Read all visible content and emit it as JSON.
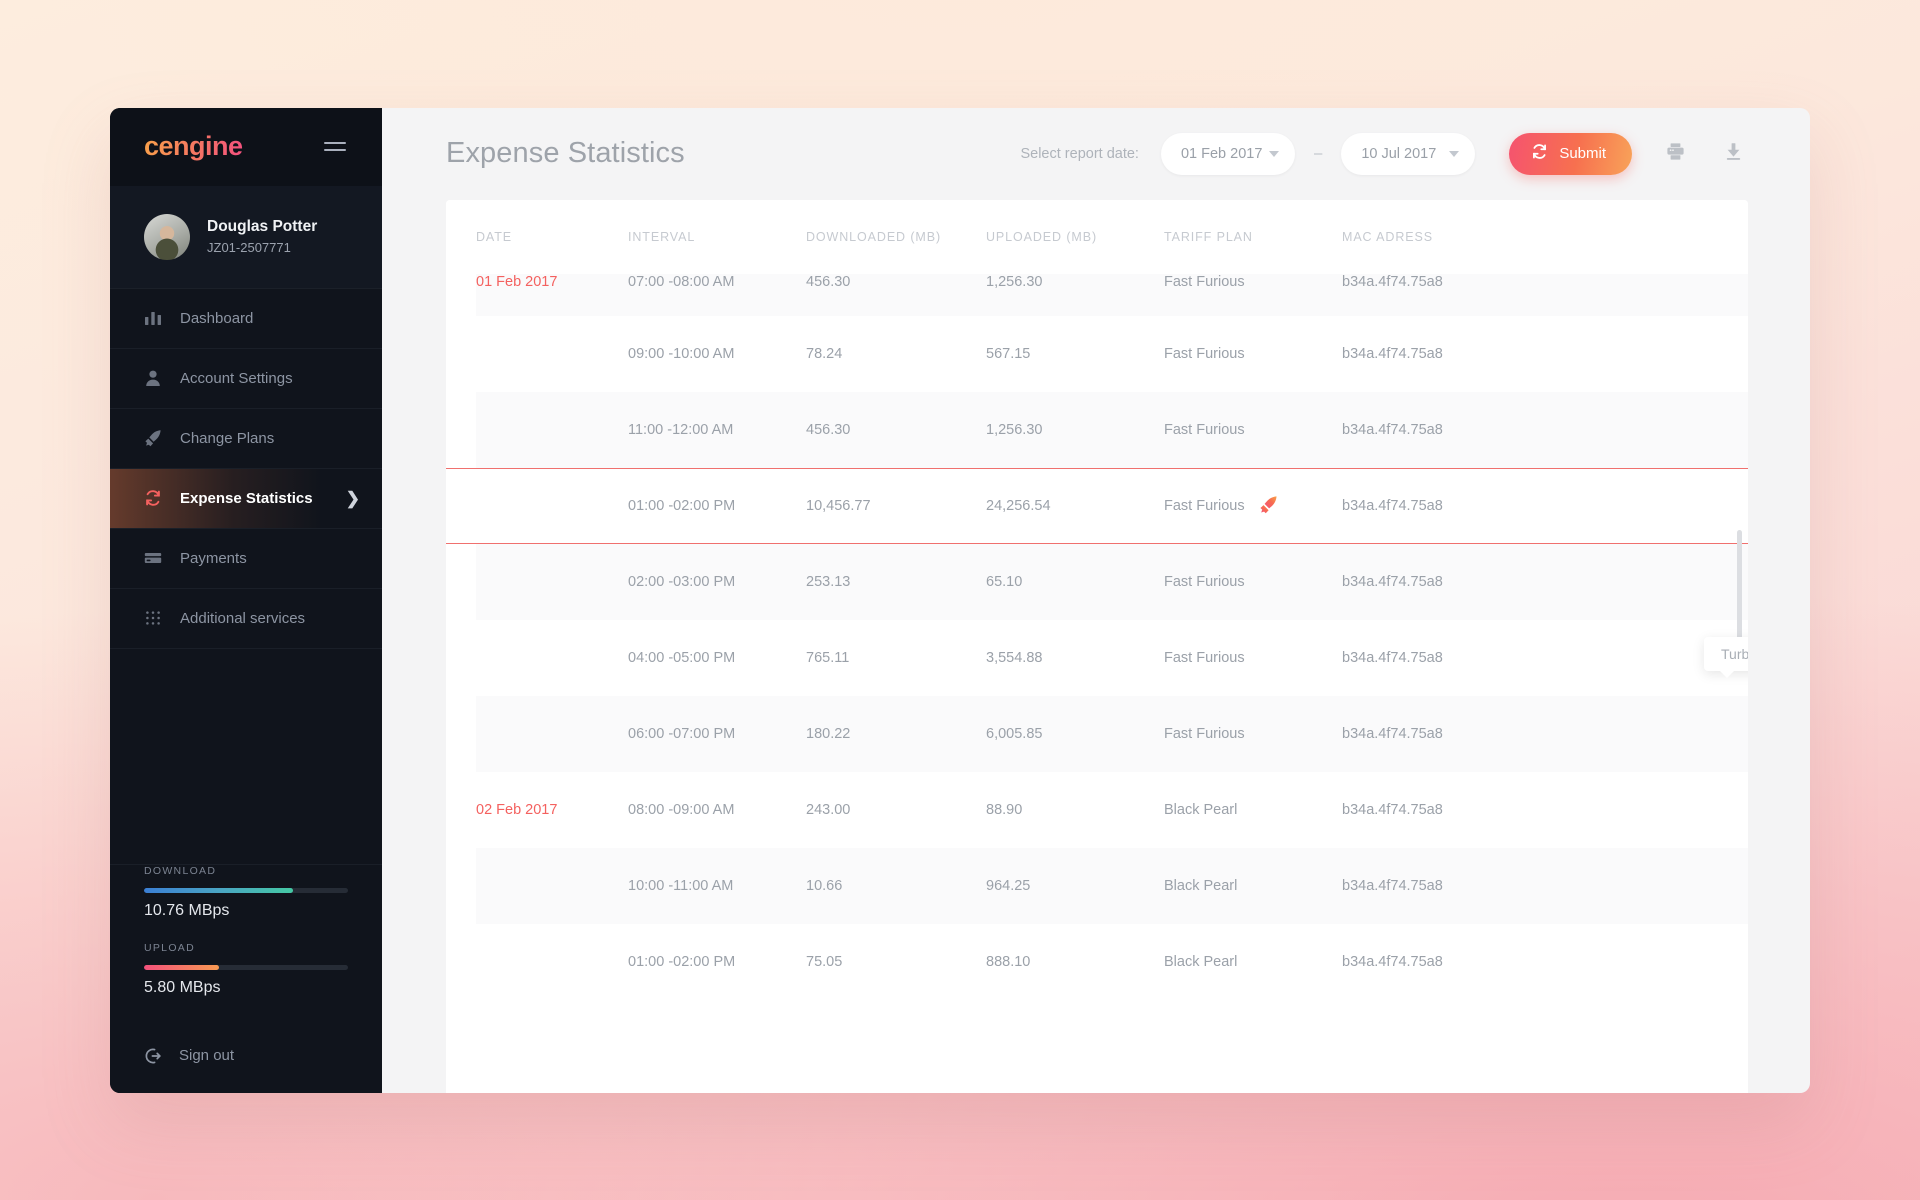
{
  "brand": {
    "logo_text": "cengine"
  },
  "profile": {
    "name": "Douglas Potter",
    "id": "JZ01-2507771"
  },
  "sidebar": {
    "items": [
      {
        "label": "Dashboard",
        "icon": "bar-chart-icon",
        "active": false
      },
      {
        "label": "Account Settings",
        "icon": "user-icon",
        "active": false
      },
      {
        "label": "Change Plans",
        "icon": "rocket-icon",
        "active": false
      },
      {
        "label": "Expense Statistics",
        "icon": "refresh-icon",
        "active": true
      },
      {
        "label": "Payments",
        "icon": "credit-card-icon",
        "active": false
      },
      {
        "label": "Additional services",
        "icon": "grid-dots-icon",
        "active": false
      }
    ],
    "meters": {
      "download_label": "DOWNLOAD",
      "download_value": "10.76 MBps",
      "download_percent": 73,
      "upload_label": "UPLOAD",
      "upload_value": "5.80 MBps",
      "upload_percent": 37
    },
    "signout_label": "Sign out"
  },
  "header": {
    "title": "Expense Statistics",
    "report_date_label": "Select report date:",
    "date_from": "01 Feb 2017",
    "date_to": "10 Jul 2017",
    "date_separator": "–",
    "submit_label": "Submit"
  },
  "table": {
    "columns": [
      "DATE",
      "INTERVAL",
      "DOWNLOADED (MB)",
      "UPLOADED (MB)",
      "TARIFF PLAN",
      "MAC ADRESS"
    ],
    "rows": [
      {
        "date": "01 Feb 2017",
        "interval": "07:00 -08:00 AM",
        "downloaded": "456.30",
        "uploaded": "1,256.30",
        "tariff": "Fast Furious",
        "mac": "b34a.4f74.75a8",
        "clipped": true
      },
      {
        "date": "",
        "interval": "09:00 -10:00 AM",
        "downloaded": "78.24",
        "uploaded": "567.15",
        "tariff": "Fast Furious",
        "mac": "b34a.4f74.75a8"
      },
      {
        "date": "",
        "interval": "11:00 -12:00 AM",
        "downloaded": "456.30",
        "uploaded": "1,256.30",
        "tariff": "Fast Furious",
        "mac": "b34a.4f74.75a8"
      },
      {
        "date": "",
        "interval": "01:00 -02:00 PM",
        "downloaded": "10,456.77",
        "uploaded": "24,256.54",
        "tariff": "Fast Furious",
        "mac": "b34a.4f74.75a8",
        "highlighted": true,
        "turbo": true
      },
      {
        "date": "",
        "interval": "02:00 -03:00 PM",
        "downloaded": "253.13",
        "uploaded": "65.10",
        "tariff": "Fast Furious",
        "mac": "b34a.4f74.75a8"
      },
      {
        "date": "",
        "interval": "04:00 -05:00 PM",
        "downloaded": "765.11",
        "uploaded": "3,554.88",
        "tariff": "Fast Furious",
        "mac": "b34a.4f74.75a8"
      },
      {
        "date": "",
        "interval": "06:00 -07:00 PM",
        "downloaded": "180.22",
        "uploaded": "6,005.85",
        "tariff": "Fast Furious",
        "mac": "b34a.4f74.75a8"
      },
      {
        "date": "02 Feb 2017",
        "interval": "08:00 -09:00 AM",
        "downloaded": "243.00",
        "uploaded": "88.90",
        "tariff": "Black Pearl",
        "mac": "b34a.4f74.75a8"
      },
      {
        "date": "",
        "interval": "10:00 -11:00 AM",
        "downloaded": "10.66",
        "uploaded": "964.25",
        "tariff": "Black Pearl",
        "mac": "b34a.4f74.75a8"
      },
      {
        "date": "",
        "interval": "01:00 -02:00 PM",
        "downloaded": "75.05",
        "uploaded": "888.10",
        "tariff": "Black Pearl",
        "mac": "b34a.4f74.75a8"
      }
    ]
  },
  "tooltip": {
    "text": "Turbo Active"
  },
  "colors": {
    "accent_red": "#f4615f",
    "accent_orange": "#f8a359",
    "sidebar_bg": "#10141c",
    "content_bg": "#f4f4f5"
  }
}
